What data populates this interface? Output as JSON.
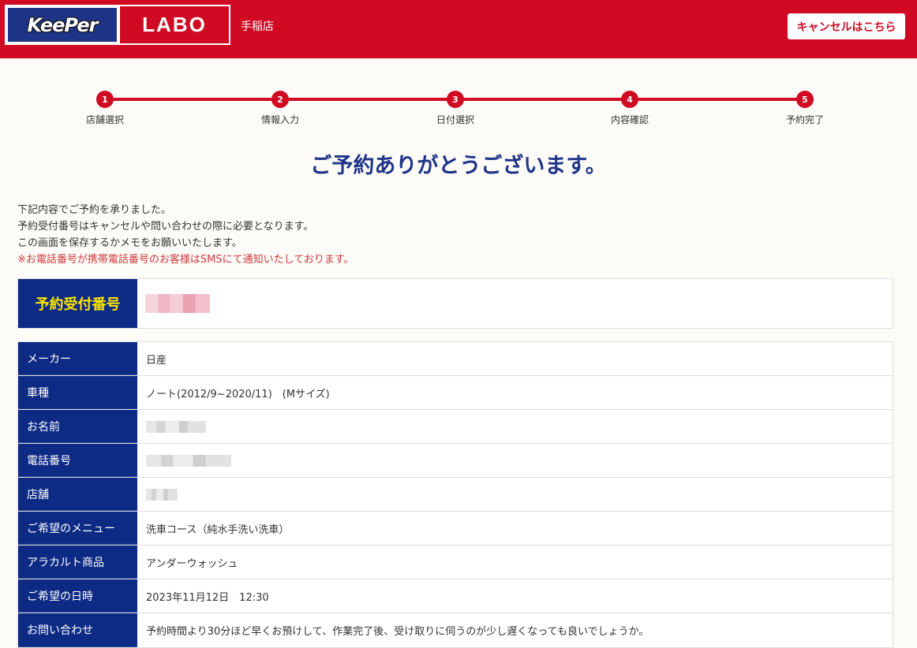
{
  "header": {
    "logo_keeper": "KeePer",
    "logo_labo": "LABO",
    "shop_name": "手稲店",
    "cancel_label": "キャンセルはこちら"
  },
  "steps": [
    {
      "num": "1",
      "label": "店舗選択"
    },
    {
      "num": "2",
      "label": "情報入力"
    },
    {
      "num": "3",
      "label": "日付選択"
    },
    {
      "num": "4",
      "label": "内容確認"
    },
    {
      "num": "5",
      "label": "予約完了"
    }
  ],
  "title": "ご予約ありがとうございます。",
  "intro": {
    "line1": "下記内容でご予約を承りました。",
    "line2": "予約受付番号はキャンセルや問い合わせの際に必要となります。",
    "line3": "この画面を保存するかメモをお願いいたします。",
    "note": "※お電話番号が携帯電話番号のお客様はSMSにて通知いたしております。"
  },
  "reservation": {
    "label": "予約受付番号"
  },
  "details": [
    {
      "label": "メーカー",
      "value": "日産"
    },
    {
      "label": "車種",
      "value": "ノート(2012/9~2020/11)　(Mサイズ)"
    },
    {
      "label": "お名前",
      "value": ""
    },
    {
      "label": "電話番号",
      "value": ""
    },
    {
      "label": "店舗",
      "value": ""
    },
    {
      "label": "ご希望のメニュー",
      "value": "洗車コース（純水手洗い洗車）"
    },
    {
      "label": "アラカルト商品",
      "value": "アンダーウォッシュ"
    },
    {
      "label": "ご希望の日時",
      "value": "2023年11月12日　12:30"
    },
    {
      "label": "お問い合わせ",
      "value": "予約時間より30分ほど早くお預けして、作業完了後、受け取りに伺うのが少し遅くなっても良いでしょうか。"
    }
  ],
  "colors": {
    "brand_red": "#cf0a22",
    "brand_navy": "#0d2b85",
    "title_blue": "#1e3487",
    "note_red": "#d0393d",
    "highlight_yellow": "#ffe600"
  }
}
